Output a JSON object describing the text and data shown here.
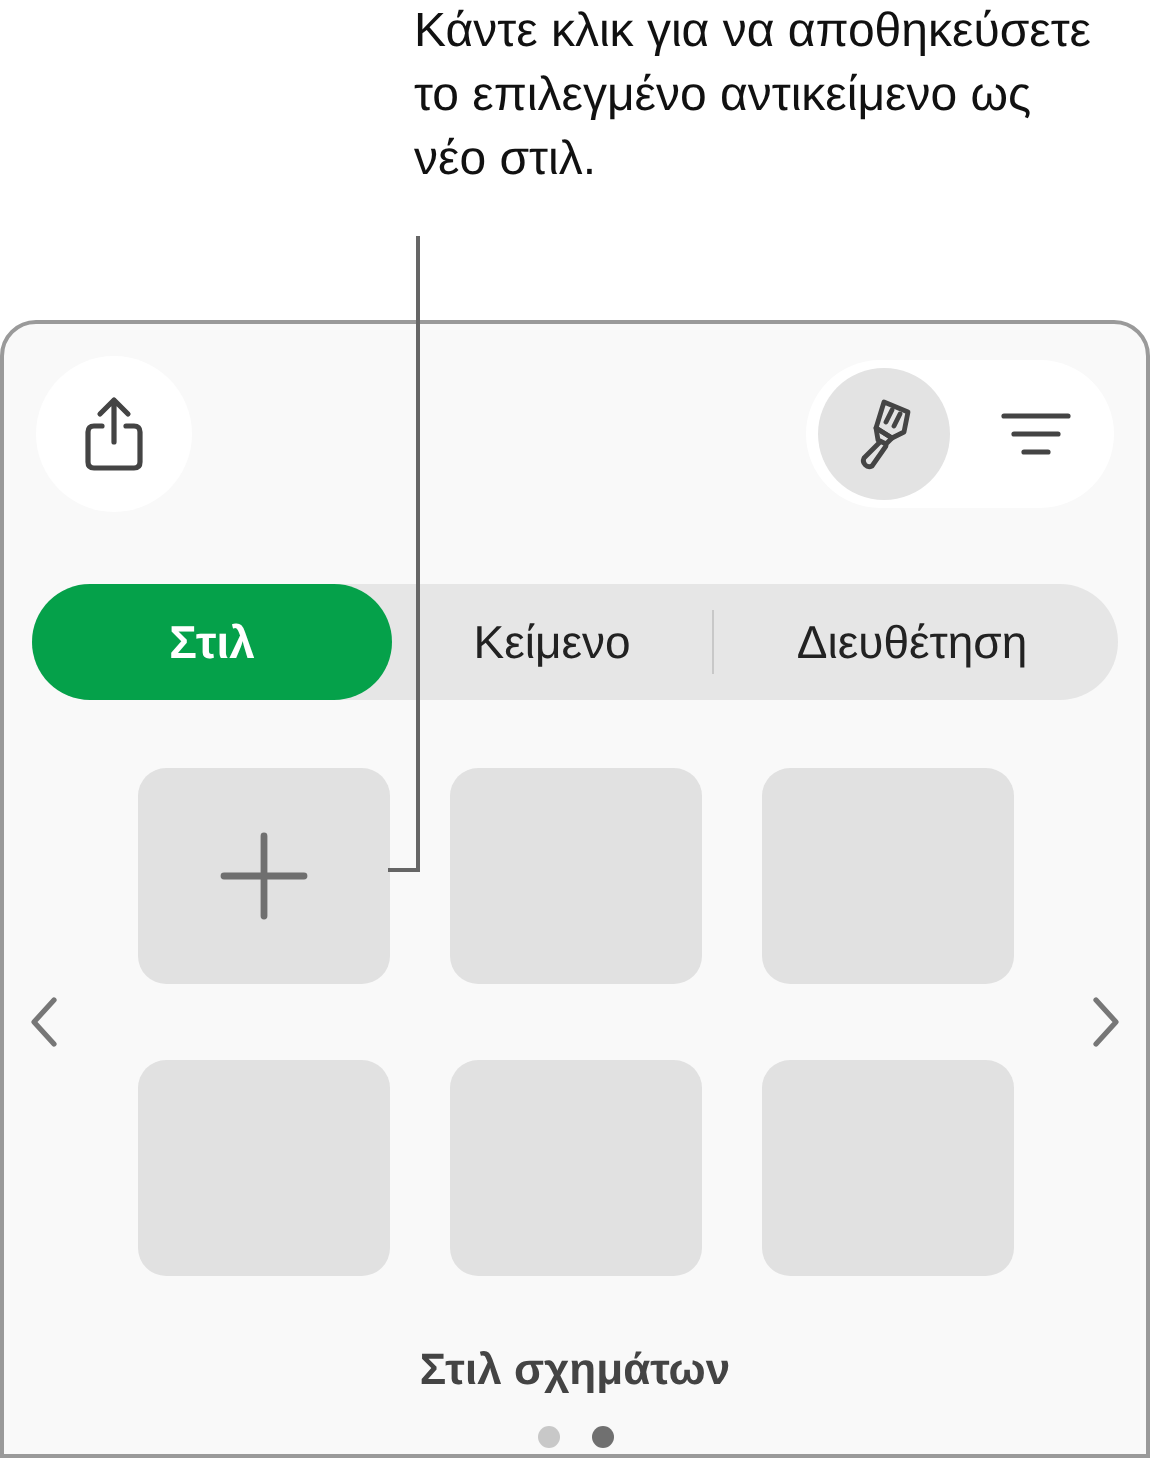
{
  "callout": {
    "text": "Κάντε κλικ για να αποθηκεύσετε το επιλεγμένο αντικείμενο ως νέο στιλ."
  },
  "format_buttons": [
    {
      "kind": "brush",
      "selected": true
    },
    {
      "kind": "lines",
      "selected": false
    }
  ],
  "tabs": [
    {
      "label": "Στιλ",
      "selected": true
    },
    {
      "label": "Κείμενο",
      "selected": false
    },
    {
      "label": "Διευθέτηση",
      "selected": false
    }
  ],
  "tiles": [
    {
      "kind": "add"
    },
    {
      "kind": "empty"
    },
    {
      "kind": "empty"
    },
    {
      "kind": "empty"
    },
    {
      "kind": "empty"
    },
    {
      "kind": "empty"
    }
  ],
  "caption": "Στιλ σχημάτων",
  "page_dots": [
    {
      "selected": false
    },
    {
      "selected": true
    }
  ]
}
